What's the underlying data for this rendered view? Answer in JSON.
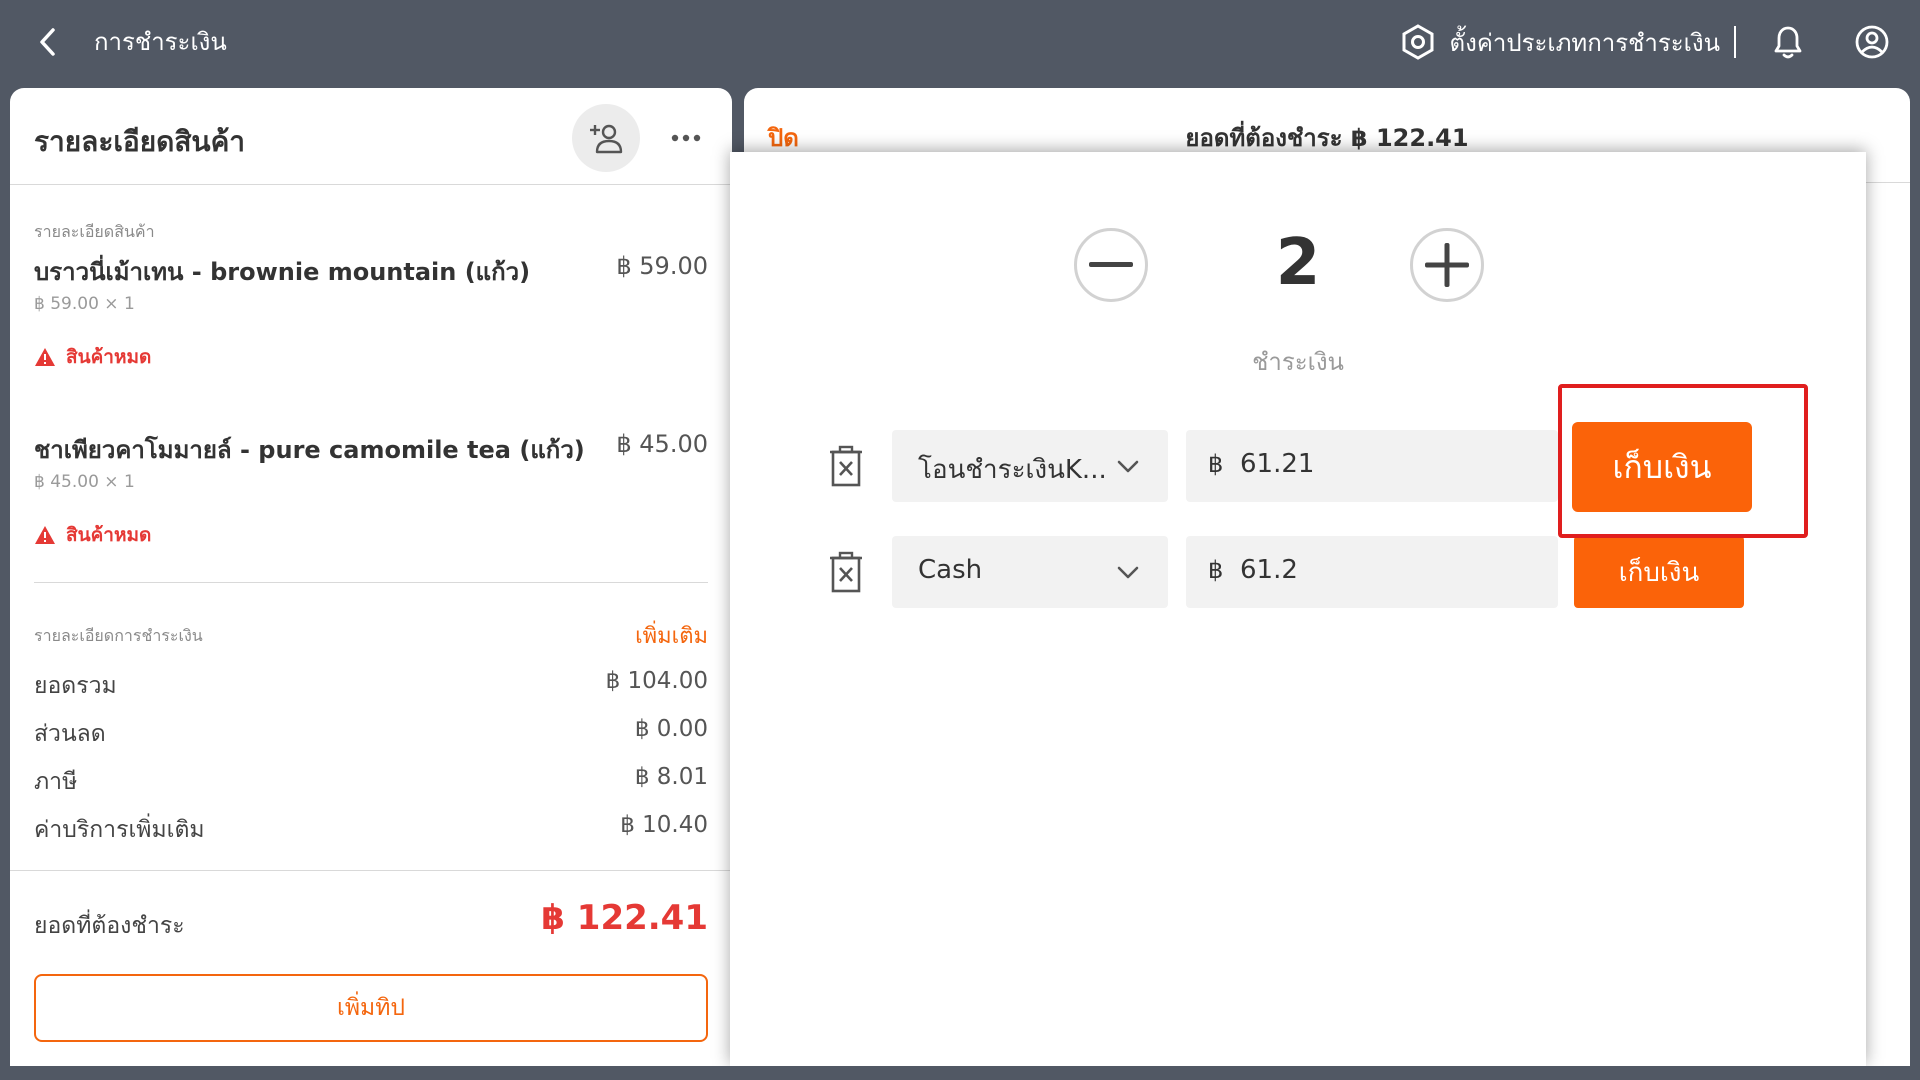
{
  "topbar": {
    "title": "การชำระเงิน",
    "settings_label": "ตั้งค่าประเภทการชำระเงิน",
    "icons": [
      "back-icon",
      "settings-hex-icon",
      "bell-icon",
      "user-circle-icon"
    ]
  },
  "left_panel": {
    "title": "รายละเอียดสินค้า",
    "products_caption": "รายละเอียดสินค้า",
    "items": [
      {
        "name": "บราวนี่เม้าเทน - brownie mountain (แก้ว)",
        "price": "฿ 59.00",
        "sub": "฿ 59.00 × 1",
        "warning": "สินค้าหมด"
      },
      {
        "name": "ชาเพียวคาโมมายล์ - pure camomile tea (แก้ว)",
        "price": "฿ 45.00",
        "sub": "฿ 45.00 × 1",
        "warning": "สินค้าหมด"
      }
    ],
    "payment_caption": "รายละเอียดการชำระเงิน",
    "add_more": "เพิ่มเติม",
    "summary": [
      {
        "label": "ยอดรวม",
        "value": "฿ 104.00"
      },
      {
        "label": "ส่วนลด",
        "value": "฿ 0.00"
      },
      {
        "label": "ภาษี",
        "value": "฿ 8.01"
      },
      {
        "label": "ค่าบริการเพิ่มเติม",
        "value": "฿ 10.40"
      }
    ],
    "total_label": "ยอดที่ต้องชำระ",
    "total_value": "฿ 122.41",
    "tip_button": "เพิ่มทิป"
  },
  "right_panel": {
    "close_label": "ปิด",
    "due_title": "ยอดที่ต้องชำระ ฿ 122.41"
  },
  "split": {
    "count": "2",
    "caption": "ชำระเงิน",
    "rows": [
      {
        "method": "โอนชำระเงินK...",
        "currency": "฿",
        "amount": "61.21",
        "collect_label": "เก็บเงิน"
      },
      {
        "method": "Cash",
        "currency": "฿",
        "amount": "61.2",
        "collect_label": "เก็บเงิน"
      }
    ]
  },
  "colors": {
    "topbar_bg": "#515864",
    "accent_orange": "#fb6309",
    "warning_red": "#e53935",
    "highlight_red": "#e01e1e"
  }
}
